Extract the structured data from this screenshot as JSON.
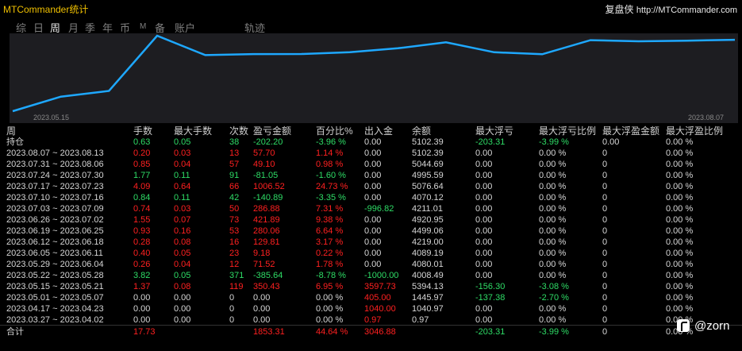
{
  "titlebar": {
    "title": "MTCommander统计",
    "brand": "复盘侠",
    "url": "http://MTCommander.com"
  },
  "tabs": [
    {
      "label": "综",
      "active": false
    },
    {
      "label": "日",
      "active": false
    },
    {
      "label": "周",
      "active": true
    },
    {
      "label": "月",
      "active": false
    },
    {
      "label": "季",
      "active": false
    },
    {
      "label": "年",
      "active": false
    },
    {
      "label": "币",
      "active": false
    },
    {
      "label": "M",
      "active": false
    },
    {
      "label": "备",
      "active": false
    },
    {
      "label": "账户",
      "active": false
    },
    {
      "label": "轨迹",
      "active": false
    }
  ],
  "chart_data": {
    "type": "line",
    "x_start_label": "2023.05.15",
    "x_end_label": "2023.08.07",
    "values": [
      0.97,
      1040.97,
      1445.97,
      5394.13,
      4008.49,
      4080.01,
      4089.19,
      4219.0,
      4499.06,
      4920.95,
      4211.01,
      4070.12,
      5076.64,
      4995.59,
      5044.69,
      5102.39
    ],
    "line_color": "#1ea8ff",
    "background": "#1d1d21"
  },
  "table": {
    "headers": [
      "周",
      "手数",
      "最大手数",
      "次数",
      "盈亏金额",
      "百分比%",
      "出入金",
      "余额",
      "最大浮亏",
      "最大浮亏比例",
      "最大浮盈金额",
      "最大浮盈比例"
    ],
    "rows": [
      {
        "period": "持仓",
        "lots": "0.63",
        "max_lots": "0.05",
        "count": "38",
        "pnl": "-202.20",
        "pct": "-3.96 %",
        "flow": "0.00",
        "balance": "5102.39",
        "max_fl": "-203.31",
        "max_fl_pct": "-3.99 %",
        "max_fp": "0.00",
        "max_fp_pct": "0.00 %",
        "tone": "pos",
        "flow_tone": "neu",
        "fl_tone": "pos"
      },
      {
        "period": "2023.08.07 ~ 2023.08.13",
        "lots": "0.20",
        "max_lots": "0.03",
        "count": "13",
        "pnl": "57.70",
        "pct": "1.14 %",
        "flow": "0.00",
        "balance": "5102.39",
        "max_fl": "0.00",
        "max_fl_pct": "0.00 %",
        "max_fp": "0",
        "max_fp_pct": "0.00 %",
        "tone": "neg",
        "flow_tone": "neu",
        "fl_tone": "neu"
      },
      {
        "period": "2023.07.31 ~ 2023.08.06",
        "lots": "0.85",
        "max_lots": "0.04",
        "count": "57",
        "pnl": "49.10",
        "pct": "0.98 %",
        "flow": "0.00",
        "balance": "5044.69",
        "max_fl": "0.00",
        "max_fl_pct": "0.00 %",
        "max_fp": "0",
        "max_fp_pct": "0.00 %",
        "tone": "neg",
        "flow_tone": "neu",
        "fl_tone": "neu"
      },
      {
        "period": "2023.07.24 ~ 2023.07.30",
        "lots": "1.77",
        "max_lots": "0.11",
        "count": "91",
        "pnl": "-81.05",
        "pct": "-1.60 %",
        "flow": "0.00",
        "balance": "4995.59",
        "max_fl": "0.00",
        "max_fl_pct": "0.00 %",
        "max_fp": "0",
        "max_fp_pct": "0.00 %",
        "tone": "pos",
        "flow_tone": "neu",
        "fl_tone": "neu"
      },
      {
        "period": "2023.07.17 ~ 2023.07.23",
        "lots": "4.09",
        "max_lots": "0.64",
        "count": "66",
        "pnl": "1006.52",
        "pct": "24.73 %",
        "flow": "0.00",
        "balance": "5076.64",
        "max_fl": "0.00",
        "max_fl_pct": "0.00 %",
        "max_fp": "0",
        "max_fp_pct": "0.00 %",
        "tone": "neg",
        "flow_tone": "neu",
        "fl_tone": "neu"
      },
      {
        "period": "2023.07.10 ~ 2023.07.16",
        "lots": "0.84",
        "max_lots": "0.11",
        "count": "42",
        "pnl": "-140.89",
        "pct": "-3.35 %",
        "flow": "0.00",
        "balance": "4070.12",
        "max_fl": "0.00",
        "max_fl_pct": "0.00 %",
        "max_fp": "0",
        "max_fp_pct": "0.00 %",
        "tone": "pos",
        "flow_tone": "neu",
        "fl_tone": "neu"
      },
      {
        "period": "2023.07.03 ~ 2023.07.09",
        "lots": "0.74",
        "max_lots": "0.03",
        "count": "50",
        "pnl": "286.88",
        "pct": "7.31 %",
        "flow": "-996.82",
        "balance": "4211.01",
        "max_fl": "0.00",
        "max_fl_pct": "0.00 %",
        "max_fp": "0",
        "max_fp_pct": "0.00 %",
        "tone": "neg",
        "flow_tone": "pos",
        "fl_tone": "neu"
      },
      {
        "period": "2023.06.26 ~ 2023.07.02",
        "lots": "1.55",
        "max_lots": "0.07",
        "count": "73",
        "pnl": "421.89",
        "pct": "9.38 %",
        "flow": "0.00",
        "balance": "4920.95",
        "max_fl": "0.00",
        "max_fl_pct": "0.00 %",
        "max_fp": "0",
        "max_fp_pct": "0.00 %",
        "tone": "neg",
        "flow_tone": "neu",
        "fl_tone": "neu"
      },
      {
        "period": "2023.06.19 ~ 2023.06.25",
        "lots": "0.93",
        "max_lots": "0.16",
        "count": "53",
        "pnl": "280.06",
        "pct": "6.64 %",
        "flow": "0.00",
        "balance": "4499.06",
        "max_fl": "0.00",
        "max_fl_pct": "0.00 %",
        "max_fp": "0",
        "max_fp_pct": "0.00 %",
        "tone": "neg",
        "flow_tone": "neu",
        "fl_tone": "neu"
      },
      {
        "period": "2023.06.12 ~ 2023.06.18",
        "lots": "0.28",
        "max_lots": "0.08",
        "count": "16",
        "pnl": "129.81",
        "pct": "3.17 %",
        "flow": "0.00",
        "balance": "4219.00",
        "max_fl": "0.00",
        "max_fl_pct": "0.00 %",
        "max_fp": "0",
        "max_fp_pct": "0.00 %",
        "tone": "neg",
        "flow_tone": "neu",
        "fl_tone": "neu"
      },
      {
        "period": "2023.06.05 ~ 2023.06.11",
        "lots": "0.40",
        "max_lots": "0.05",
        "count": "23",
        "pnl": "9.18",
        "pct": "0.22 %",
        "flow": "0.00",
        "balance": "4089.19",
        "max_fl": "0.00",
        "max_fl_pct": "0.00 %",
        "max_fp": "0",
        "max_fp_pct": "0.00 %",
        "tone": "neg",
        "flow_tone": "neu",
        "fl_tone": "neu"
      },
      {
        "period": "2023.05.29 ~ 2023.06.04",
        "lots": "0.26",
        "max_lots": "0.04",
        "count": "12",
        "pnl": "71.52",
        "pct": "1.78 %",
        "flow": "0.00",
        "balance": "4080.01",
        "max_fl": "0.00",
        "max_fl_pct": "0.00 %",
        "max_fp": "0",
        "max_fp_pct": "0.00 %",
        "tone": "neg",
        "flow_tone": "neu",
        "fl_tone": "neu"
      },
      {
        "period": "2023.05.22 ~ 2023.05.28",
        "lots": "3.82",
        "max_lots": "0.05",
        "count": "371",
        "pnl": "-385.64",
        "pct": "-8.78 %",
        "flow": "-1000.00",
        "balance": "4008.49",
        "max_fl": "0.00",
        "max_fl_pct": "0.00 %",
        "max_fp": "0",
        "max_fp_pct": "0.00 %",
        "tone": "pos",
        "flow_tone": "pos",
        "fl_tone": "neu"
      },
      {
        "period": "2023.05.15 ~ 2023.05.21",
        "lots": "1.37",
        "max_lots": "0.08",
        "count": "119",
        "pnl": "350.43",
        "pct": "6.95 %",
        "flow": "3597.73",
        "balance": "5394.13",
        "max_fl": "-156.30",
        "max_fl_pct": "-3.08 %",
        "max_fp": "0",
        "max_fp_pct": "0.00 %",
        "tone": "neg",
        "flow_tone": "neg",
        "fl_tone": "pos"
      },
      {
        "period": "2023.05.01 ~ 2023.05.07",
        "lots": "0.00",
        "max_lots": "0.00",
        "count": "0",
        "pnl": "0.00",
        "pct": "0.00 %",
        "flow": "405.00",
        "balance": "1445.97",
        "max_fl": "-137.38",
        "max_fl_pct": "-2.70 %",
        "max_fp": "0",
        "max_fp_pct": "0.00 %",
        "tone": "neu",
        "flow_tone": "neg",
        "fl_tone": "pos"
      },
      {
        "period": "2023.04.17 ~ 2023.04.23",
        "lots": "0.00",
        "max_lots": "0.00",
        "count": "0",
        "pnl": "0.00",
        "pct": "0.00 %",
        "flow": "1040.00",
        "balance": "1040.97",
        "max_fl": "0.00",
        "max_fl_pct": "0.00 %",
        "max_fp": "0",
        "max_fp_pct": "0.00 %",
        "tone": "neu",
        "flow_tone": "neg",
        "fl_tone": "neu"
      },
      {
        "period": "2023.03.27 ~ 2023.04.02",
        "lots": "0.00",
        "max_lots": "0.00",
        "count": "0",
        "pnl": "0.00",
        "pct": "0.00 %",
        "flow": "0.97",
        "balance": "0.97",
        "max_fl": "0.00",
        "max_fl_pct": "0.00 %",
        "max_fp": "0",
        "max_fp_pct": "0.00 %",
        "tone": "neu",
        "flow_tone": "neg",
        "fl_tone": "neu"
      }
    ],
    "total": {
      "period": "合计",
      "lots": "17.73",
      "pnl": "1853.31",
      "pct": "44.64 %",
      "flow": "3046.88",
      "max_fl": "-203.31",
      "max_fl_pct": "-3.99 %",
      "max_fp": "0",
      "max_fp_pct": "0.00 %"
    }
  },
  "watermark": {
    "text": "@zorn",
    "icon": "app-logo-icon"
  },
  "colors": {
    "positive": "#2edc66",
    "negative": "#ff2020",
    "title": "#f0c000",
    "line": "#1ea8ff"
  }
}
